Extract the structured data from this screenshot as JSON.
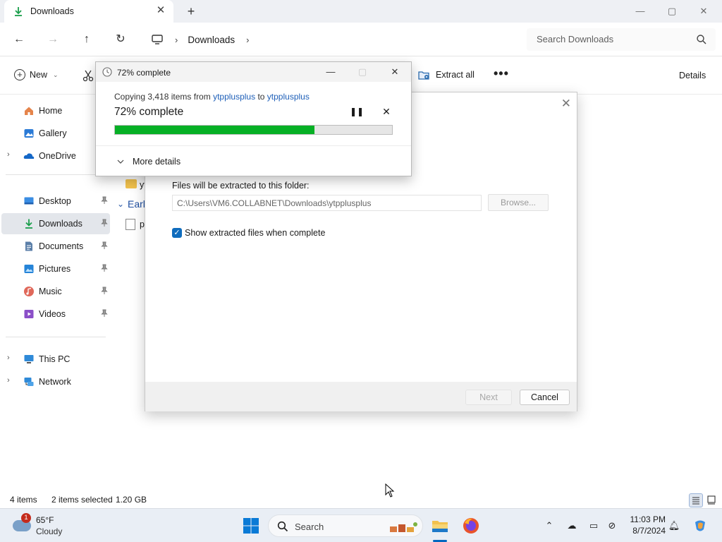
{
  "explorer": {
    "tab_title": "Downloads",
    "new_tab_symbol": "+",
    "window_controls": {
      "minimize": "—",
      "maximize": "▢",
      "close": "✕"
    },
    "address": {
      "location": "Downloads"
    },
    "search": {
      "placeholder": "Search Downloads"
    },
    "commands": {
      "new_label": "New",
      "extract_all_label": "Extract all",
      "more_label": "•••",
      "details_label": "Details"
    },
    "sidebar": {
      "home": "Home",
      "gallery": "Gallery",
      "onedrive": "OneDrive",
      "desktop": "Desktop",
      "downloads": "Downloads",
      "documents": "Documents",
      "pictures": "Pictures",
      "music": "Music",
      "videos": "Videos",
      "this_pc": "This PC",
      "network": "Network"
    },
    "content": {
      "folder_name_partial": "yt",
      "group_partial": "Earl",
      "file_partial": "p"
    },
    "status": {
      "item_count": "4 items",
      "selection": "2 items selected",
      "size": "1.20 GB"
    }
  },
  "wizard": {
    "folder_label": "Files will be extracted to this folder:",
    "path_value": "C:\\Users\\VM6.COLLABNET\\Downloads\\ytpplusplus",
    "browse_label": "Browse...",
    "show_files_label": "Show extracted files when complete",
    "show_files_checked": true,
    "next_label": "Next",
    "cancel_label": "Cancel"
  },
  "progress": {
    "title": "72% complete",
    "copy_prefix": "Copying 3,418 items from ",
    "copy_from": "ytpplusplus",
    "copy_mid": " to ",
    "copy_to": "ytpplusplus",
    "percent_label": "72% complete",
    "percent_value": 72,
    "more_details_label": "More details",
    "bar_color": "#06b025"
  },
  "taskbar": {
    "weather_temp": "65°F",
    "weather_cond": "Cloudy",
    "weather_badge": "1",
    "search_label": "Search",
    "time": "11:03 PM",
    "date": "8/7/2024"
  }
}
